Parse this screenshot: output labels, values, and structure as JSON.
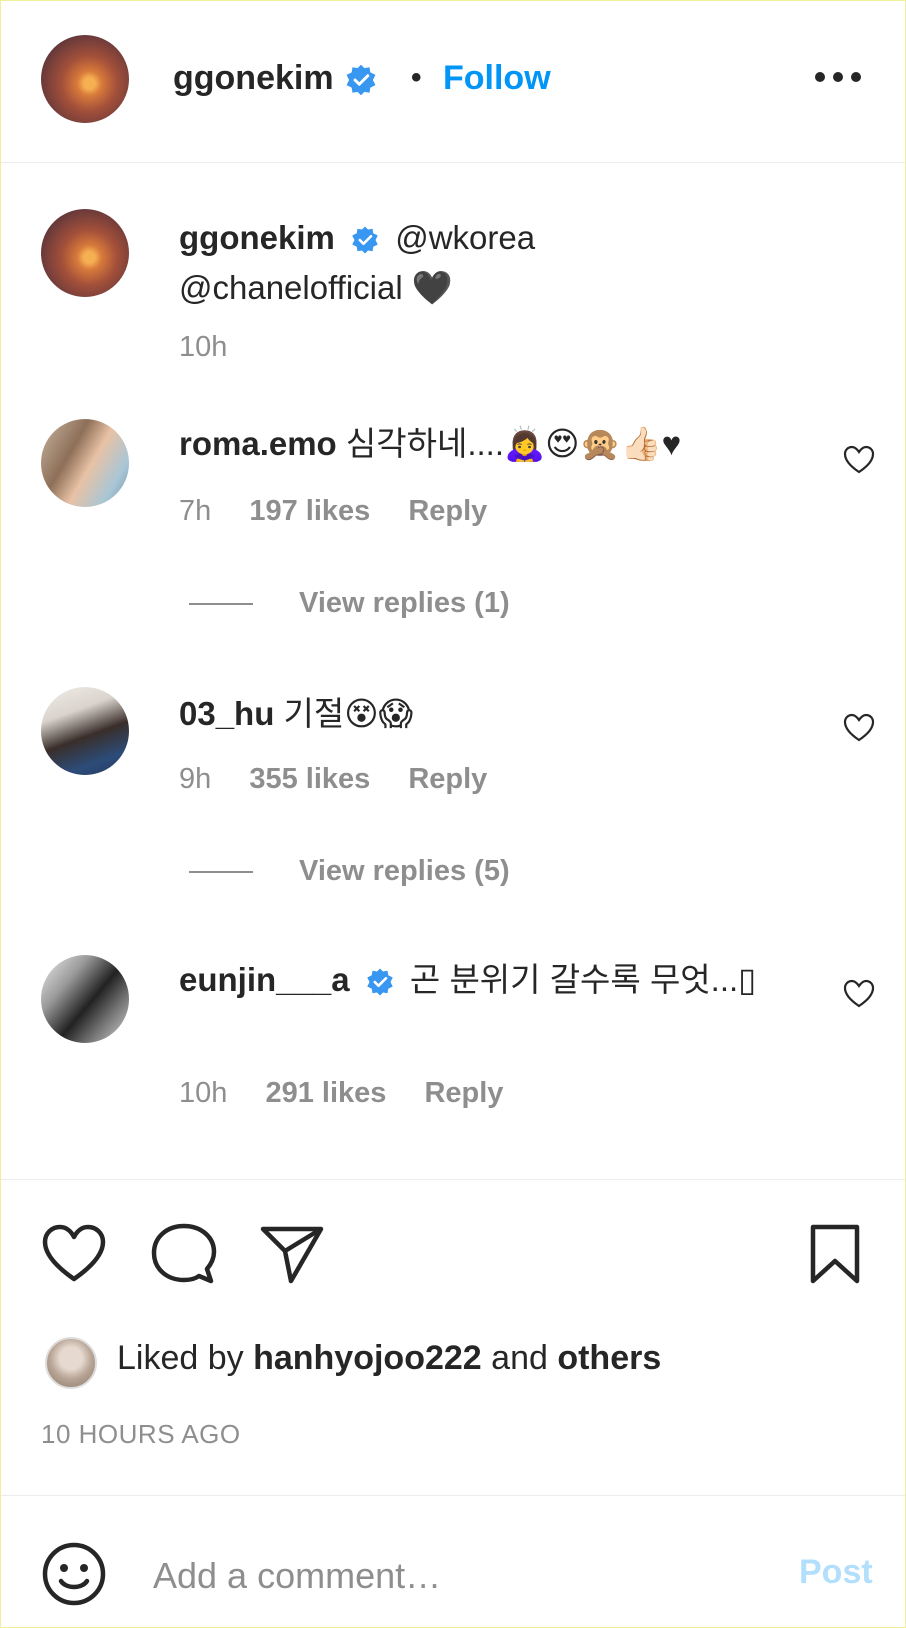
{
  "header": {
    "username": "ggonekim",
    "separator": "•",
    "follow_label": "Follow"
  },
  "caption": {
    "username": "ggonekim",
    "text_line1": "@wkorea",
    "text_line2": "@chanelofficial 🖤",
    "time": "10h"
  },
  "comments": [
    {
      "username": "roma.emo",
      "text": "심각하네....🙇‍♀️😍🙊👍🏻♥",
      "time": "7h",
      "likes": "197 likes",
      "reply_label": "Reply",
      "view_replies": "View replies (1)"
    },
    {
      "username": "03_hu",
      "text": "기절😵😱",
      "time": "9h",
      "likes": "355 likes",
      "reply_label": "Reply",
      "view_replies": "View replies (5)"
    },
    {
      "username": "eunjin___a",
      "text": "곤 분위기 갈수록 무엇...▯",
      "time": "10h",
      "likes": "291 likes",
      "reply_label": "Reply"
    }
  ],
  "likes_bar": {
    "prefix": "Liked by",
    "user": "hanhyojoo222",
    "conjunction": "and",
    "others": "others",
    "posted": "10 HOURS AGO"
  },
  "comment_box": {
    "placeholder": "Add a comment…",
    "post_label": "Post"
  },
  "colors": {
    "accent": "#0095f6",
    "verified": "#3897f0",
    "muted": "#8e8e8e",
    "post_disabled": "#b2dffc"
  },
  "icons": [
    "verified-badge-icon",
    "more-options-icon",
    "heart-icon",
    "comment-icon",
    "share-icon",
    "bookmark-icon",
    "smile-icon"
  ]
}
